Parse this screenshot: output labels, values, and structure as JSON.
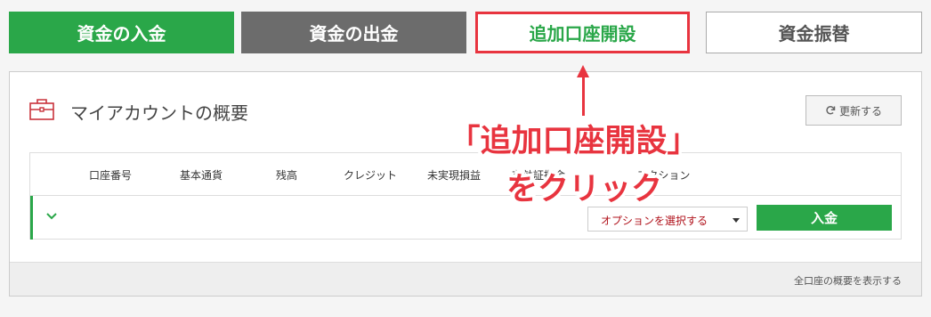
{
  "top_buttons": {
    "deposit": "資金の入金",
    "withdraw": "資金の出金",
    "open_account": "追加口座開設",
    "transfer": "資金振替"
  },
  "panel": {
    "title": "マイアカウントの概要",
    "refresh_label": "更新する",
    "footer_link": "全口座の概要を表示する"
  },
  "table": {
    "headers": [
      "口座番号",
      "基本通貨",
      "残高",
      "クレジット",
      "未実現損益",
      "有効証拠金",
      "アクション"
    ],
    "row": {
      "select_placeholder": "オプションを選択する",
      "deposit_button": "入金"
    }
  },
  "annotation": {
    "line1": "｢追加口座開設｣",
    "line2": "をクリック"
  },
  "colors": {
    "brand_green": "#2aa749",
    "highlight_red": "#e8343f",
    "withdraw_gray": "#6c6c6c"
  },
  "icons": {
    "briefcase": "briefcase-icon",
    "refresh": "refresh-icon",
    "expand": "chevron-down-icon",
    "dropdown": "caret-down-icon",
    "pointer": "arrow-up-icon"
  }
}
